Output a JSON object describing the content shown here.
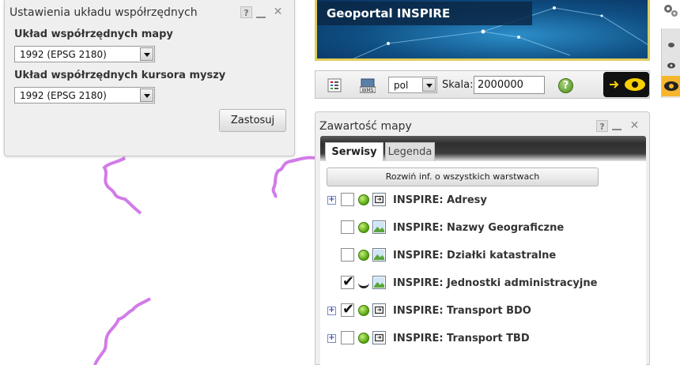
{
  "coordinate_panel": {
    "title": "Ustawienia układu współrzędnych",
    "controls": {
      "help": "?",
      "minimize": "_",
      "close": "✕"
    },
    "map_crs_label": "Układ współrzędnych mapy",
    "map_crs_value": "1992 (EPSG 2180)",
    "cursor_crs_label": "Układ współrzędnych kursora myszy",
    "cursor_crs_value": "1992 (EPSG 2180)",
    "apply_button": "Zastosuj"
  },
  "banner": {
    "title": "Geoportal INSPIRE"
  },
  "toolbar": {
    "language_value": "pol",
    "scale_label": "Skala:",
    "scale_value": "2000000",
    "help_glyph": "?"
  },
  "map_content_panel": {
    "title": "Zawartość mapy",
    "controls": {
      "help": "?",
      "minimize": "_",
      "close": "✕"
    },
    "tabs": [
      {
        "label": "Serwisy",
        "active": true
      },
      {
        "label": "Legenda",
        "active": false
      }
    ],
    "expand_all_button": "Rozwiń inf. o wszystkich warstwach",
    "layers": [
      {
        "name": "INSPIRE: Adresy",
        "expandable": true,
        "checked": false,
        "status": "green",
        "type_icon": "service-icon"
      },
      {
        "name": "INSPIRE: Nazwy Geograficzne",
        "expandable": false,
        "checked": false,
        "status": "green",
        "type_icon": "image-icon"
      },
      {
        "name": "INSPIRE: Działki katastralne",
        "expandable": false,
        "checked": false,
        "status": "green",
        "type_icon": "image-icon"
      },
      {
        "name": "INSPIRE: Jednostki administracyjne",
        "expandable": false,
        "checked": true,
        "status": "loading",
        "type_icon": "image-icon"
      },
      {
        "name": "INSPIRE: Transport BDO",
        "expandable": true,
        "checked": true,
        "status": "green",
        "type_icon": "service-icon"
      },
      {
        "name": "INSPIRE: Transport TBD",
        "expandable": true,
        "checked": false,
        "status": "green",
        "type_icon": "service-icon"
      }
    ]
  },
  "colors": {
    "boundary_line": "#d27be8",
    "banner_border": "#e1cc5d",
    "active_view_button": "#f6b62c"
  }
}
